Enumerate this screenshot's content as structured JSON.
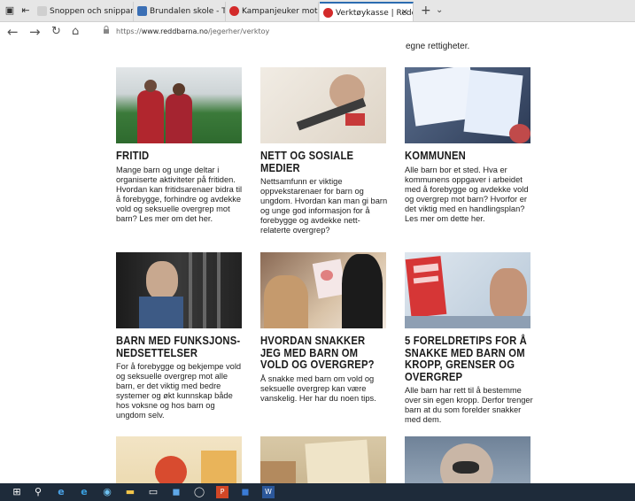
{
  "browser": {
    "tabs": [
      {
        "title": "Snoppen och snippan \"mus"
      },
      {
        "title": "Brundalen skole - Trondheir"
      },
      {
        "title": "Kampanjeuker mot vold og"
      },
      {
        "title": "Verktøykasse | Redd Bar"
      }
    ],
    "url_prefix": "https://",
    "url_domain": "www.reddbarna.no",
    "url_path": "/jegerher/verktoy"
  },
  "page": {
    "top_text": "egne rettigheter.",
    "cards": [
      {
        "title": "FRITID",
        "text": "Mange barn og unge deltar i organiserte aktiviteter på fritiden. Hvordan kan fritidsarenaer bidra til å forebygge, forhindre og avdekke vold og seksuelle overgrep mot barn? Les mer om det her."
      },
      {
        "title": "NETT OG SOSIALE MEDIER",
        "text": "Nettsamfunn er viktige oppvekstarenaer for barn og ungdom. Hvordan kan man gi barn og unge god informasjon for å forebygge og avdekke nett-relaterte overgrep?"
      },
      {
        "title": "KOMMUNEN",
        "text": "Alle barn bor et sted. Hva er kommunens oppgaver i arbeidet med å forebygge og avdekke vold og overgrep mot barn? Hvorfor er det viktig med en handlingsplan? Les mer om dette her."
      },
      {
        "title": "BARN MED FUNKSJONS-NEDSETTELSER",
        "text": "For å forebygge og bekjempe vold og seksuelle overgrep mot alle barn, er det viktig med bedre systemer og økt kunnskap både hos voksne og hos barn og ungdom selv."
      },
      {
        "title": "HVORDAN SNAKKER JEG MED BARN OM VOLD OG OVERGREP?",
        "text": "Å snakke med barn om vold og seksuelle overgrep kan være vanskelig. Her har du noen tips."
      },
      {
        "title": "5 FORELDRETIPS FOR Å SNAKKE MED BARN OM KROPP, GRENSER OG OVERGREP",
        "text": "Alle barn har rett til å bestemme over sin egen kropp. Derfor trenger barn at du som forelder snakker med dem."
      },
      {
        "title": "",
        "text": ""
      },
      {
        "title": "",
        "text": ""
      },
      {
        "title": "",
        "text": ""
      }
    ]
  },
  "colors": {
    "accent": "#d32a2a",
    "taskbar": "#1e2b3a"
  }
}
